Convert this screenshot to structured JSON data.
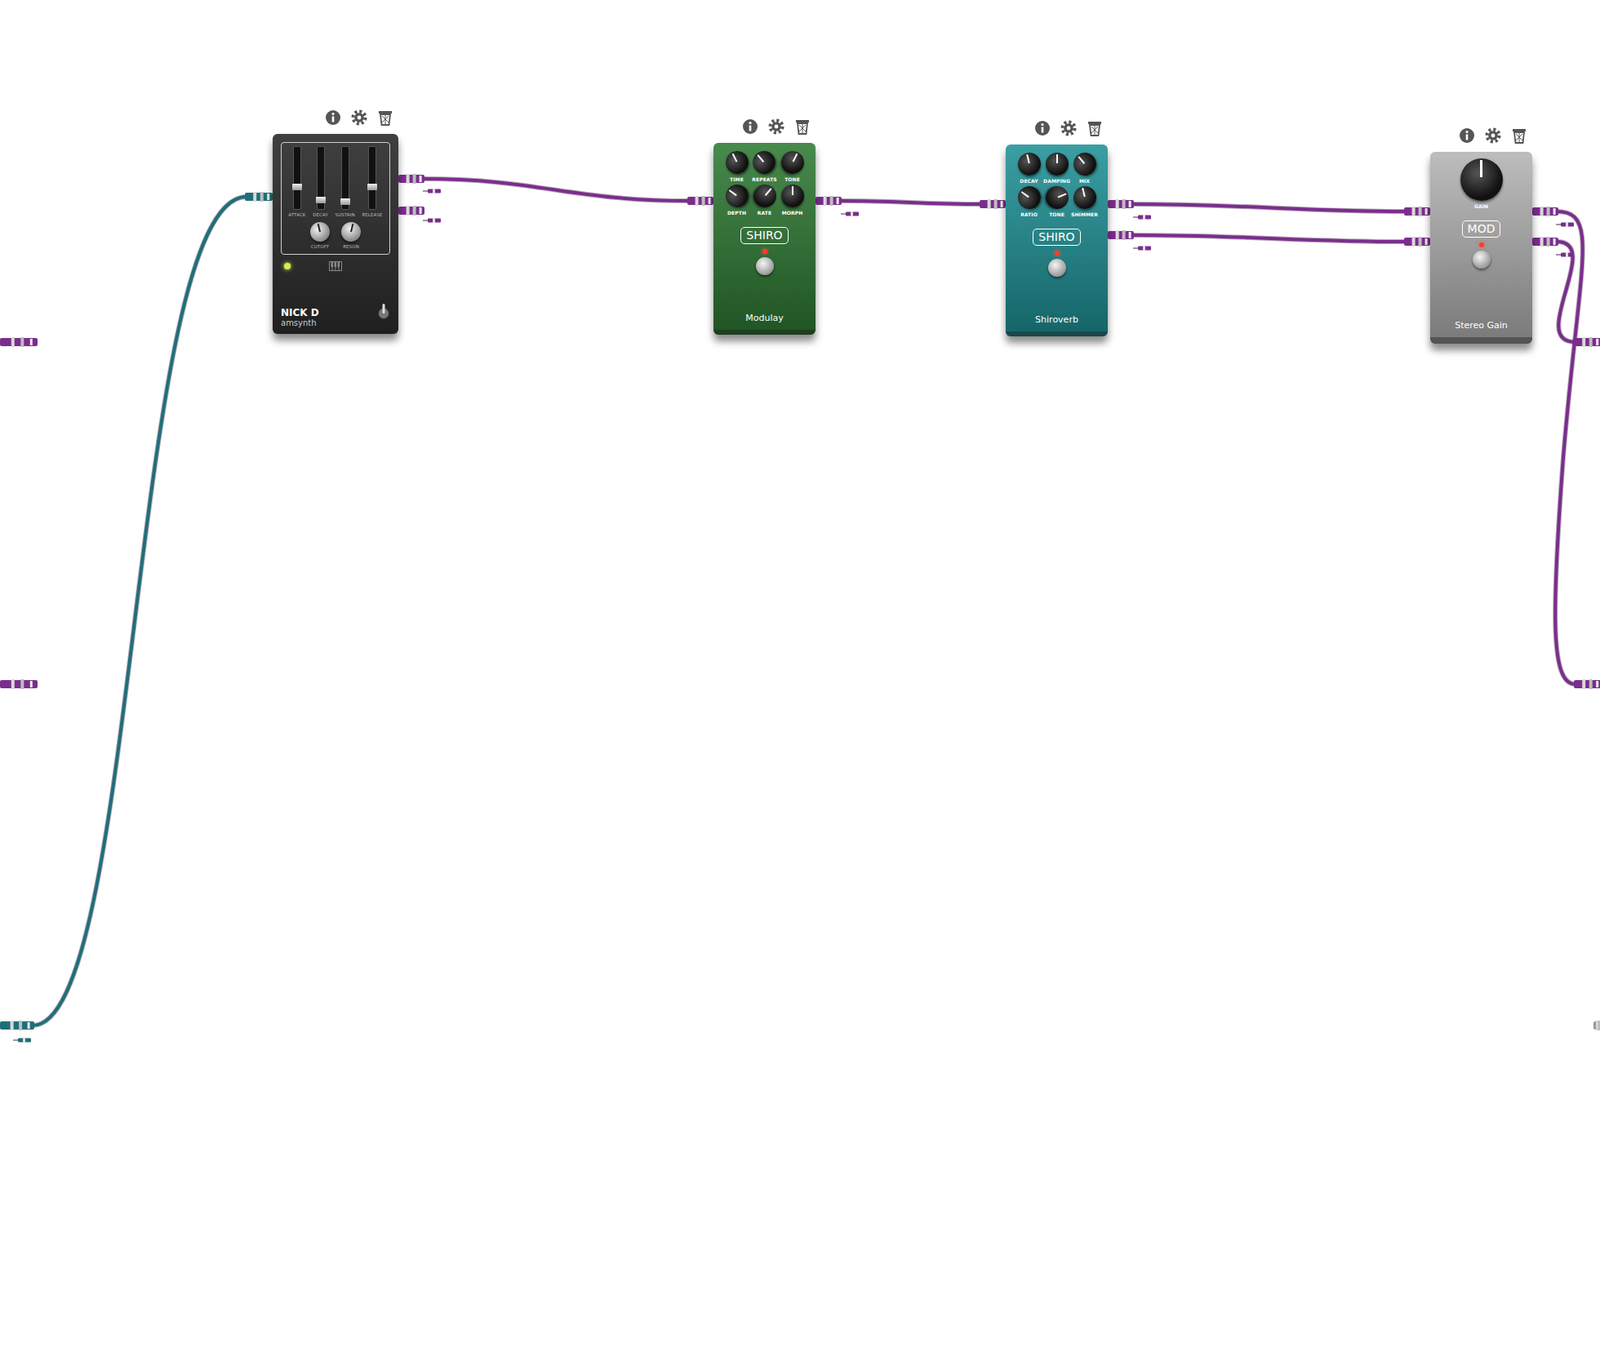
{
  "pedals": [
    {
      "brand": "NICK D",
      "name": "amsynth",
      "kind": "synth",
      "color": "#2a2a2a",
      "on": true,
      "sliders": [
        {
          "label": "ATTACK",
          "level": 0.35
        },
        {
          "label": "DECAY",
          "level": 0.15
        },
        {
          "label": "SUSTAIN",
          "level": 0.12
        },
        {
          "label": "RELEASE",
          "level": 0.35
        }
      ],
      "knobs": [
        {
          "label": "CUTOFF",
          "level": 0.45
        },
        {
          "label": "RESON",
          "level": 0.55
        }
      ]
    },
    {
      "brand": "SHIRO",
      "name": "Modulay",
      "kind": "shiro",
      "color": "#2f7a34",
      "on": true,
      "knobs": [
        {
          "label": "TIME",
          "level": 0.4
        },
        {
          "label": "REPEATS",
          "level": 0.35
        },
        {
          "label": "TONE",
          "level": 0.6
        },
        {
          "label": "DEPTH",
          "level": 0.3
        },
        {
          "label": "RATE",
          "level": 0.65
        },
        {
          "label": "MORPH",
          "level": 0.5
        }
      ]
    },
    {
      "brand": "SHIRO",
      "name": "Shiroverb",
      "kind": "shiro",
      "color": "#1f9296",
      "on": true,
      "knobs": [
        {
          "label": "DECAY",
          "level": 0.45
        },
        {
          "label": "DAMPING",
          "level": 0.5
        },
        {
          "label": "MIX",
          "level": 0.35
        },
        {
          "label": "RATIO",
          "level": 0.3
        },
        {
          "label": "TONE",
          "level": 0.75
        },
        {
          "label": "SHIMMER",
          "level": 0.45
        }
      ]
    },
    {
      "brand": "MOD",
      "name": "Stereo Gain",
      "kind": "gain",
      "color": "#9a9a9a",
      "on": true,
      "knobs": [
        {
          "label": "GAIN",
          "level": 0.5
        }
      ]
    }
  ]
}
